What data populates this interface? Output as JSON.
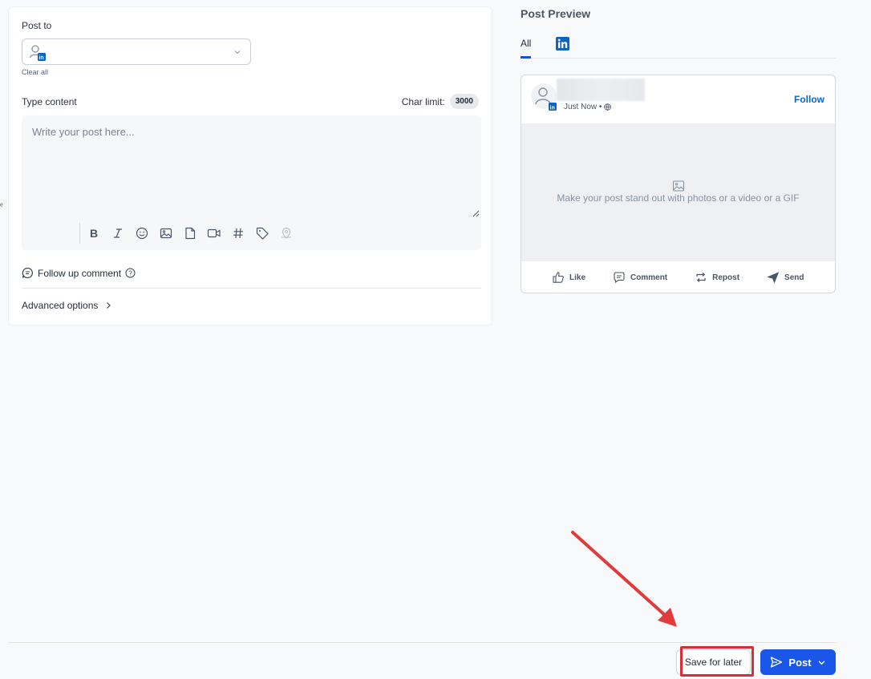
{
  "composer": {
    "post_to_label": "Post to",
    "clear_all": "Clear all",
    "type_content_label": "Type content",
    "char_limit_label": "Char limit:",
    "char_limit_value": "3000",
    "placeholder": "Write your post here...",
    "toolbar_icons": [
      "bold-icon",
      "italic-icon",
      "emoji-icon",
      "image-icon",
      "document-icon",
      "video-icon",
      "hashtag-icon",
      "tag-icon",
      "location-icon"
    ],
    "follow_up": "Follow up comment",
    "advanced": "Advanced options"
  },
  "preview": {
    "title": "Post Preview",
    "tab_all": "All",
    "time": "Just Now •",
    "follow": "Follow",
    "media_hint": "Make your post stand out with photos or a video or a GIF",
    "actions": [
      "Like",
      "Comment",
      "Repost",
      "Send"
    ]
  },
  "footer": {
    "save_label": "Save for later",
    "post_label": "Post"
  },
  "colors": {
    "accent": "#1a56e8",
    "linkedin": "#0a66c2",
    "highlight": "#d62f35"
  }
}
